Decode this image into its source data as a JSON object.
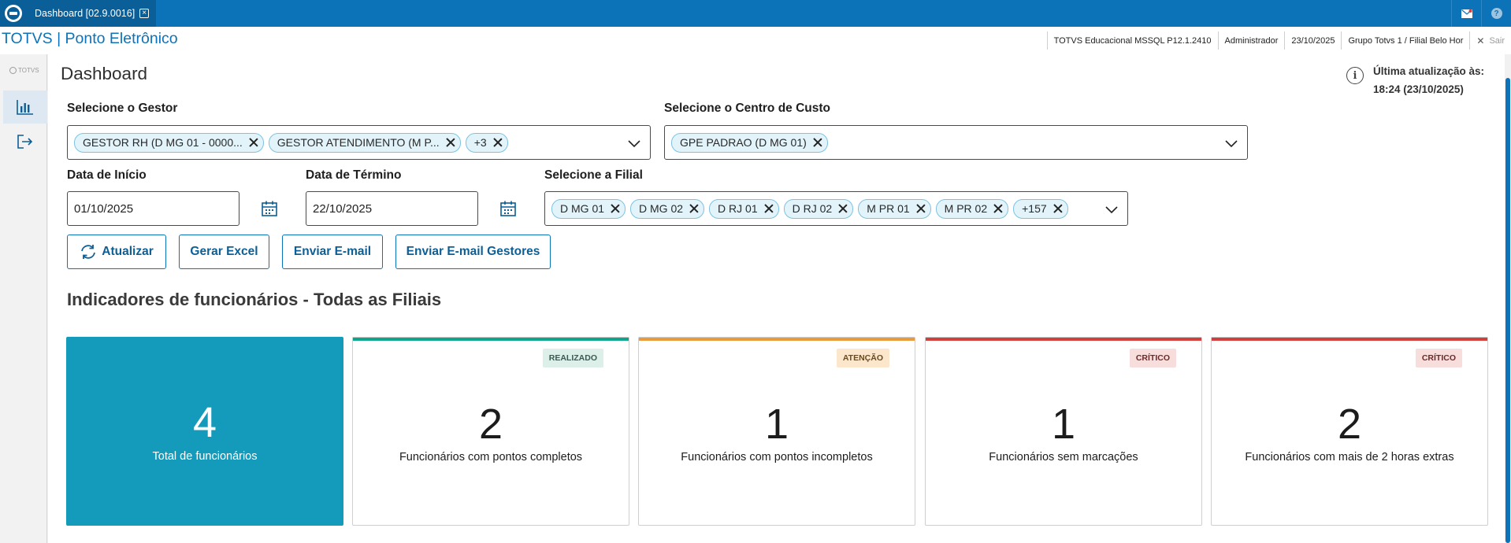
{
  "topbar": {
    "tab_label": "Dashboard [02.9.0016]",
    "tab_close_glyph": "×",
    "help_glyph": "?"
  },
  "header": {
    "app_title": "TOTVS | Ponto Eletrônico",
    "system": "TOTVS Educacional MSSQL P12.1.2410",
    "user": "Administrador",
    "date": "23/10/2025",
    "branch": "Grupo Totvs 1 / Filial Belo Hor",
    "logout": "Sair",
    "logout_glyph": "✕"
  },
  "sidenav": {
    "logo_text": "TOTVS",
    "items": [
      {
        "name": "dashboard",
        "icon": "bar-chart-icon",
        "active": true
      },
      {
        "name": "logout",
        "icon": "exit-icon",
        "active": false
      }
    ]
  },
  "page": {
    "title": "Dashboard",
    "last_update_label": "Última atualização às:",
    "last_update_value": "18:24 (23/10/2025)",
    "info_glyph": "i"
  },
  "filters": {
    "gestor_label": "Selecione o Gestor",
    "gestor_chips": [
      "GESTOR RH (D MG 01 - 0000...",
      "GESTOR ATENDIMENTO (M P...",
      "+3"
    ],
    "centro_custo_label": "Selecione o Centro de Custo",
    "centro_custo_chips": [
      "GPE PADRAO (D MG 01)"
    ],
    "data_inicio_label": "Data de Início",
    "data_inicio_value": "01/10/2025",
    "data_termino_label": "Data de Término",
    "data_termino_value": "22/10/2025",
    "filial_label": "Selecione a Filial",
    "filial_chips": [
      "D MG 01",
      "D MG 02",
      "D RJ 01",
      "D RJ 02",
      "M PR 01",
      "M PR 02",
      "+157"
    ]
  },
  "actions": {
    "atualizar": "Atualizar",
    "gerar_excel": "Gerar Excel",
    "enviar_email": "Enviar E-mail",
    "enviar_email_gestores": "Enviar E-mail Gestores"
  },
  "indicators": {
    "title": "Indicadores de funcionários - Todas as Filiais",
    "cards": [
      {
        "value": "4",
        "label": "Total de funcionários",
        "badge": "",
        "color": "#149bbb"
      },
      {
        "value": "2",
        "label": "Funcionários com pontos completos",
        "badge": "REALIZADO",
        "color": "#11a48c"
      },
      {
        "value": "1",
        "label": "Funcionários com pontos incompletos",
        "badge": "ATENÇÃO",
        "color": "#e89a3c"
      },
      {
        "value": "1",
        "label": "Funcionários sem marcações",
        "badge": "CRÍTICO",
        "color": "#d0403c"
      },
      {
        "value": "2",
        "label": "Funcionários com mais de 2 horas extras",
        "badge": "CRÍTICO",
        "color": "#d0403c"
      }
    ]
  }
}
